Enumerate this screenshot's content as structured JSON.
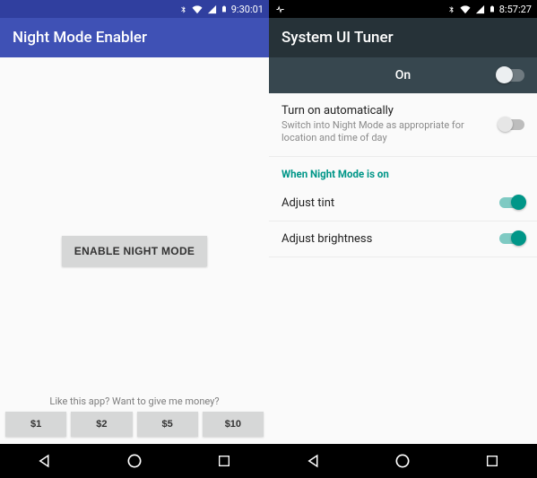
{
  "left": {
    "status": {
      "time": "9:30:01"
    },
    "appbar": {
      "title": "Night Mode Enabler"
    },
    "enable_label": "ENABLE NIGHT MODE",
    "donate": {
      "prompt": "Like this app? Want to give me money?",
      "amounts": [
        "$1",
        "$2",
        "$5",
        "$10"
      ]
    }
  },
  "right": {
    "status": {
      "time": "8:57:27"
    },
    "appbar": {
      "title": "System UI Tuner"
    },
    "master": {
      "label": "On",
      "value": false
    },
    "settings": {
      "auto": {
        "title": "Turn on automatically",
        "sub": "Switch into Night Mode as appropriate for location and time of day",
        "value": false,
        "enabled": false
      },
      "section_label": "When Night Mode is on",
      "tint": {
        "title": "Adjust tint",
        "value": true
      },
      "brightness": {
        "title": "Adjust brightness",
        "value": true
      }
    }
  }
}
